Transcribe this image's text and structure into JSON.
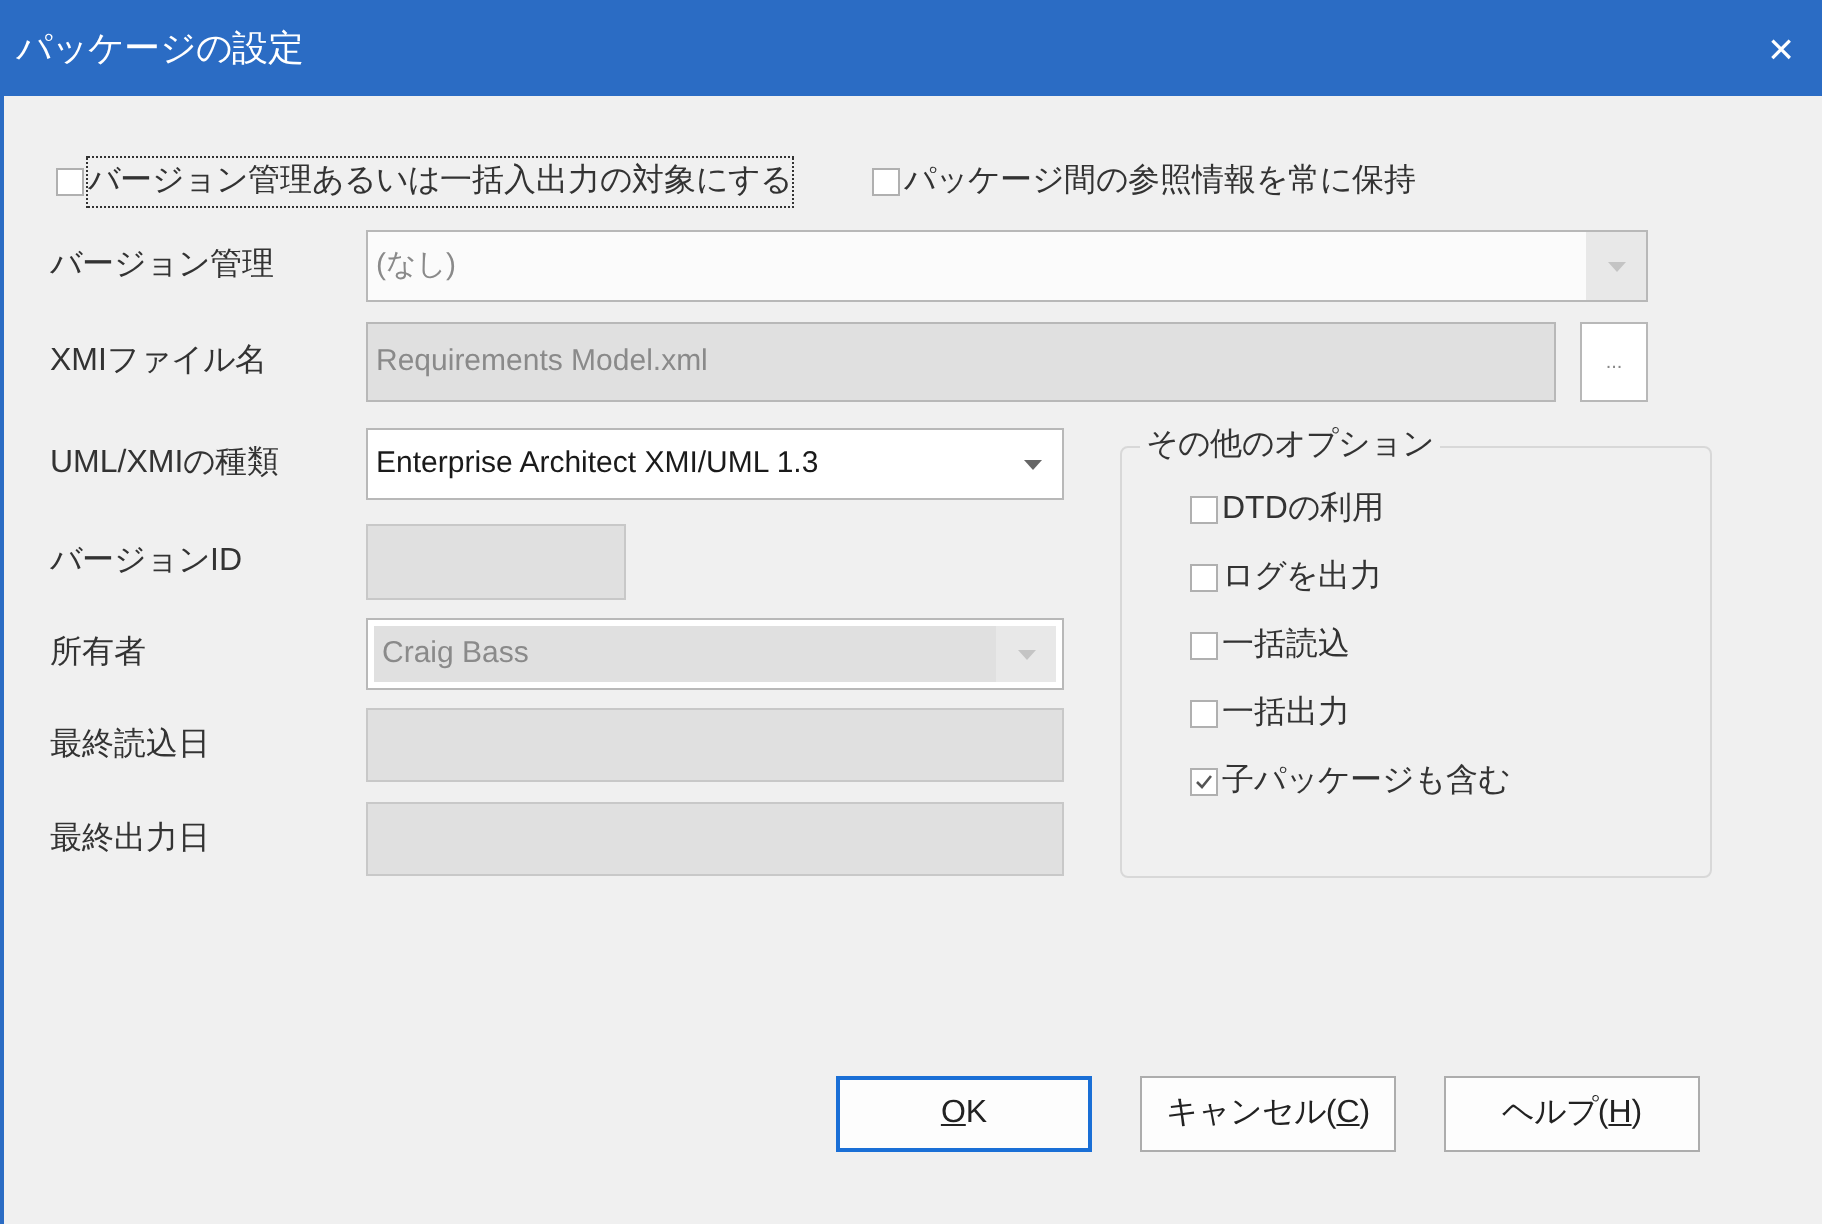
{
  "window": {
    "title": "パッケージの設定",
    "close": "×"
  },
  "top_checks": [
    {
      "label": "バージョン管理あるいは一括入出力の対象にする",
      "checked": false,
      "focused": true
    },
    {
      "label": "パッケージ間の参照情報を常に保持",
      "checked": false,
      "focused": false
    }
  ],
  "fields": [
    {
      "kind": "dropdown",
      "label": "バージョン管理",
      "value": "(なし)",
      "disabled": true
    },
    {
      "kind": "browse",
      "label": "XMIファイル名",
      "value": "Requirements Model.xml",
      "disabled": true,
      "button": "..."
    },
    {
      "kind": "dropdown",
      "label": "UML/XMIの種類",
      "value": "Enterprise Architect XMI/UML 1.3",
      "disabled": false
    },
    {
      "kind": "short",
      "label": "バージョンID",
      "disabled": true
    },
    {
      "kind": "dropdown",
      "label": "所有者",
      "value": "Craig Bass",
      "disabled": true
    },
    {
      "kind": "text",
      "label": "最終読込日",
      "disabled": true
    },
    {
      "kind": "text",
      "label": "最終出力日",
      "disabled": true
    }
  ],
  "other_options": {
    "title": "その他のオプション",
    "items": [
      {
        "label": "DTDの利用",
        "checked": false
      },
      {
        "label": "ログを出力",
        "checked": false
      },
      {
        "label": "一括読込",
        "checked": false
      },
      {
        "label": "一括出力",
        "checked": false
      },
      {
        "label": "子パッケージも含む",
        "checked": true
      }
    ]
  },
  "buttons": [
    {
      "mnemonic": "O",
      "after": "K",
      "default": true
    },
    {
      "before": "キャンセル(",
      "mnemonic": "C",
      "after": ")",
      "default": false
    },
    {
      "before": "ヘルプ(",
      "mnemonic": "H",
      "after": ")",
      "default": false
    }
  ]
}
